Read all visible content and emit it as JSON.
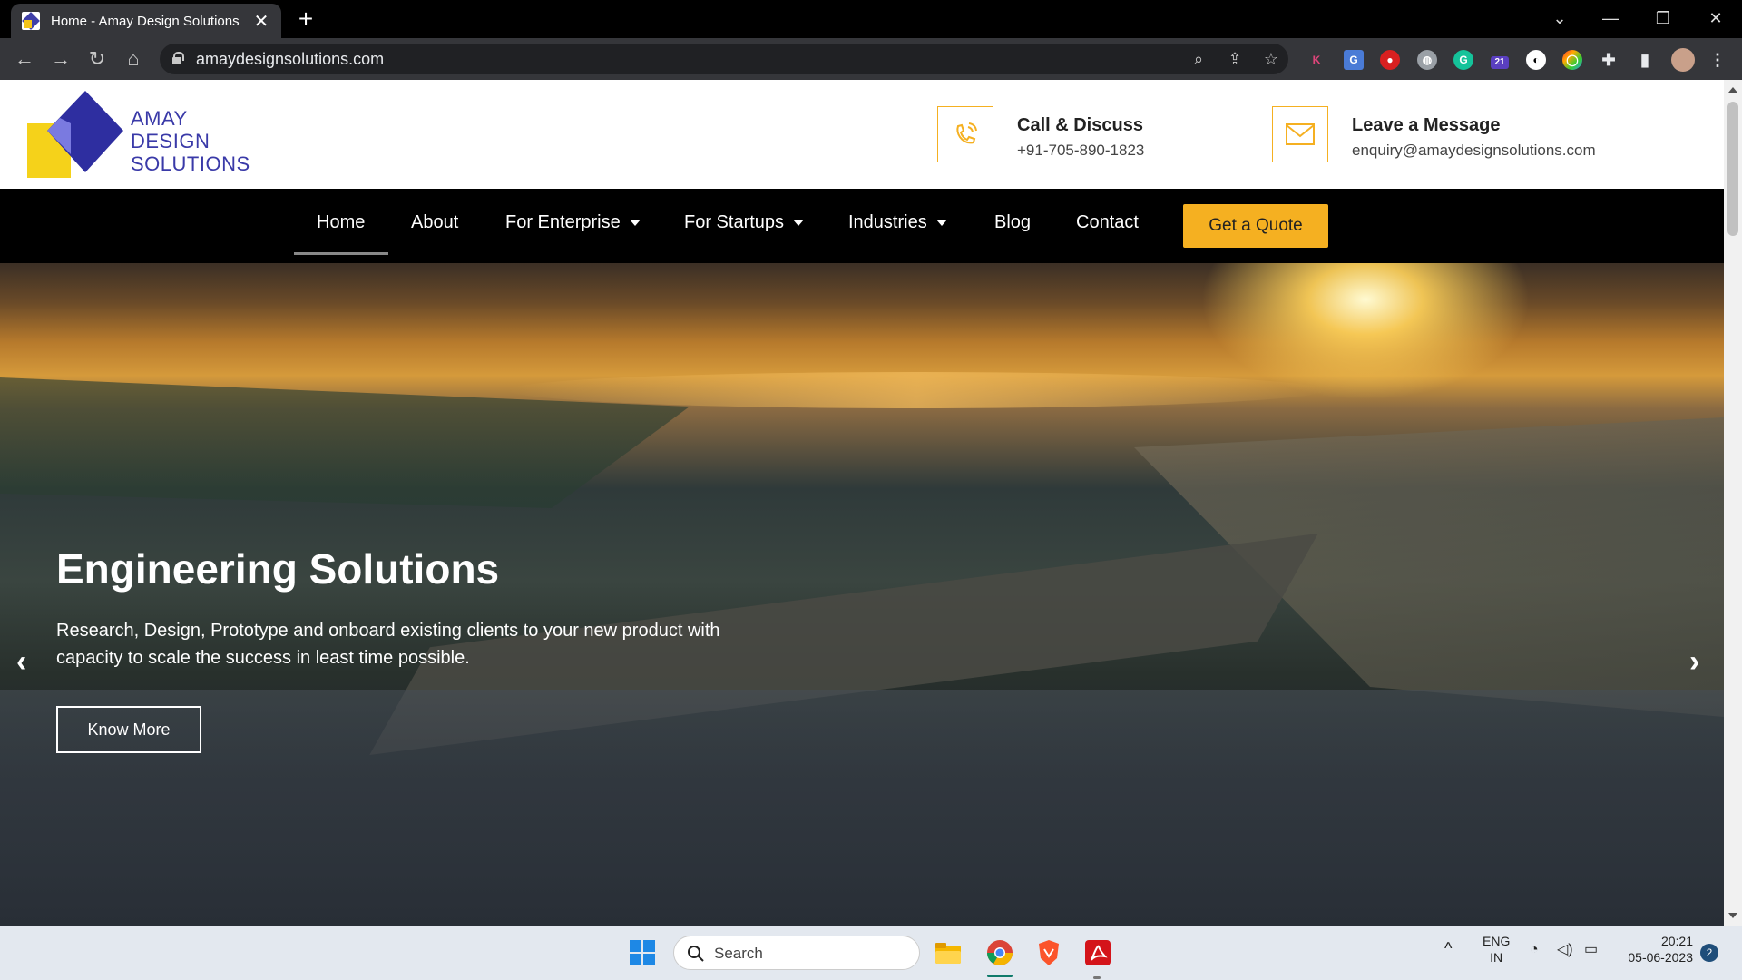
{
  "browser": {
    "tab_title": "Home - Amay Design Solutions",
    "url": "amaydesignsolutions.com",
    "new_tab": "+",
    "tab_close": "✕"
  },
  "header": {
    "logo_line1": "AMAY",
    "logo_line2": "DESIGN",
    "logo_line3": "SOLUTIONS",
    "call_title": "Call & Discuss",
    "call_value": "+91-705-890-1823",
    "message_title": "Leave a Message",
    "message_value": "enquiry@amaydesignsolutions.com"
  },
  "nav": {
    "items": [
      "Home",
      "About",
      "For Enterprise",
      "For Startups",
      "Industries",
      "Blog",
      "Contact"
    ],
    "quote": "Get a Quote"
  },
  "hero": {
    "title": "Engineering Solutions",
    "text": "Research, Design, Prototype and onboard existing clients to your new product with capacity to scale the success in least time possible.",
    "button": "Know More",
    "prev": "‹",
    "next": "›"
  },
  "taskbar": {
    "search": "Search",
    "lang1": "ENG",
    "lang2": "IN",
    "time": "20:21",
    "date": "05-06-2023",
    "notif_count": "2"
  },
  "extensions": {
    "badge": "21"
  },
  "colors": {
    "accent": "#f5b021",
    "brand_blue": "#3a3aa8",
    "brand_yellow": "#f5d21a"
  }
}
